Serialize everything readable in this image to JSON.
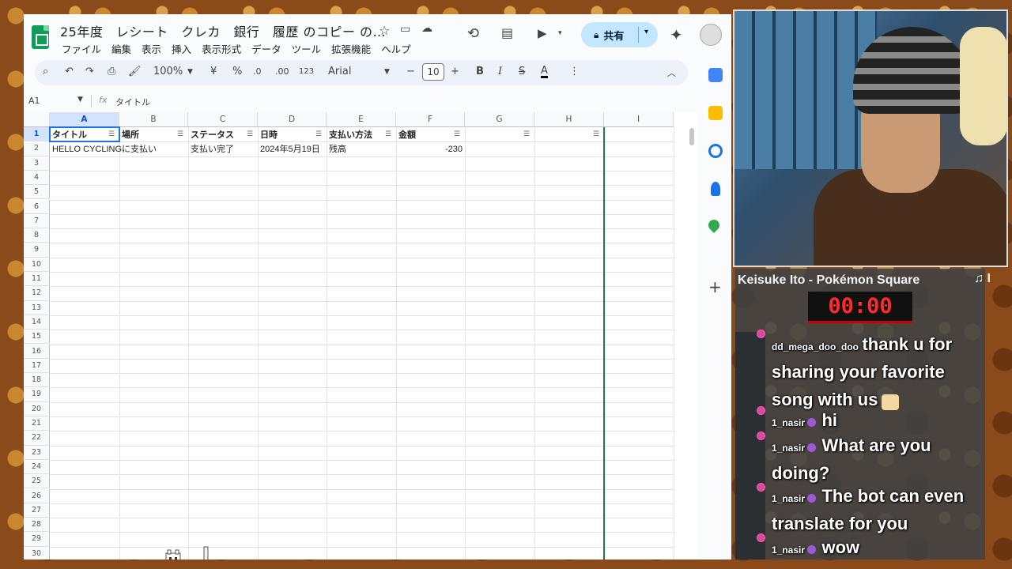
{
  "sheets": {
    "doc_title": "25年度　レシート　クレカ　銀行　履歴 のコピー の…",
    "menus": [
      "ファイル",
      "編集",
      "表示",
      "挿入",
      "表示形式",
      "データ",
      "ツール",
      "拡張機能",
      "ヘルプ"
    ],
    "share_label": "共有",
    "toolbar": {
      "zoom": "100%",
      "currency": "¥",
      "percent": "%",
      "dec_decrease": ".0",
      "dec_increase": ".00",
      "number_format": "123",
      "font": "Arial",
      "font_size": "10",
      "bold": "B",
      "italic": "I",
      "strike": "S",
      "text_color": "A"
    },
    "formula_bar": {
      "cell_ref": "A1",
      "fx": "fx",
      "value": "タイトル"
    },
    "columns": [
      "A",
      "B",
      "C",
      "D",
      "E",
      "F",
      "G",
      "H",
      "I"
    ],
    "rows": [
      "1",
      "2",
      "3",
      "4",
      "5",
      "6",
      "7",
      "8",
      "9",
      "10",
      "11",
      "12",
      "13",
      "14",
      "15",
      "16",
      "17",
      "18",
      "19",
      "20",
      "21",
      "22",
      "23",
      "24",
      "25",
      "26",
      "27",
      "28",
      "29",
      "30"
    ],
    "header_row": [
      "タイトル",
      "場所",
      "ステータス",
      "日時",
      "支払い方法",
      "金額"
    ],
    "data_rows": [
      [
        "HELLO CYCLINGに支払い",
        "",
        "支払い完了",
        "2024年5月19日",
        "残高",
        "-230"
      ]
    ]
  },
  "stream": {
    "song": "Keisuke Ito - Pokémon Square",
    "note": "♫ I",
    "timer": "00:00",
    "chat": [
      {
        "user": "dd_mega_doo_doo",
        "text": "thank u for sharing your favorite song with us"
      },
      {
        "user": "1_nasir",
        "text": "hi"
      },
      {
        "user": "1_nasir",
        "text": "What are you doing?"
      },
      {
        "user": "1_nasir",
        "text": "The bot can even translate for you"
      },
      {
        "user": "1_nasir",
        "text": "wow"
      }
    ]
  },
  "colors": {
    "accent": "#0b57d0",
    "share_bg": "#c2e7ff",
    "sheets_green": "#0f9d58",
    "timer_red": "#ff2a2a"
  }
}
